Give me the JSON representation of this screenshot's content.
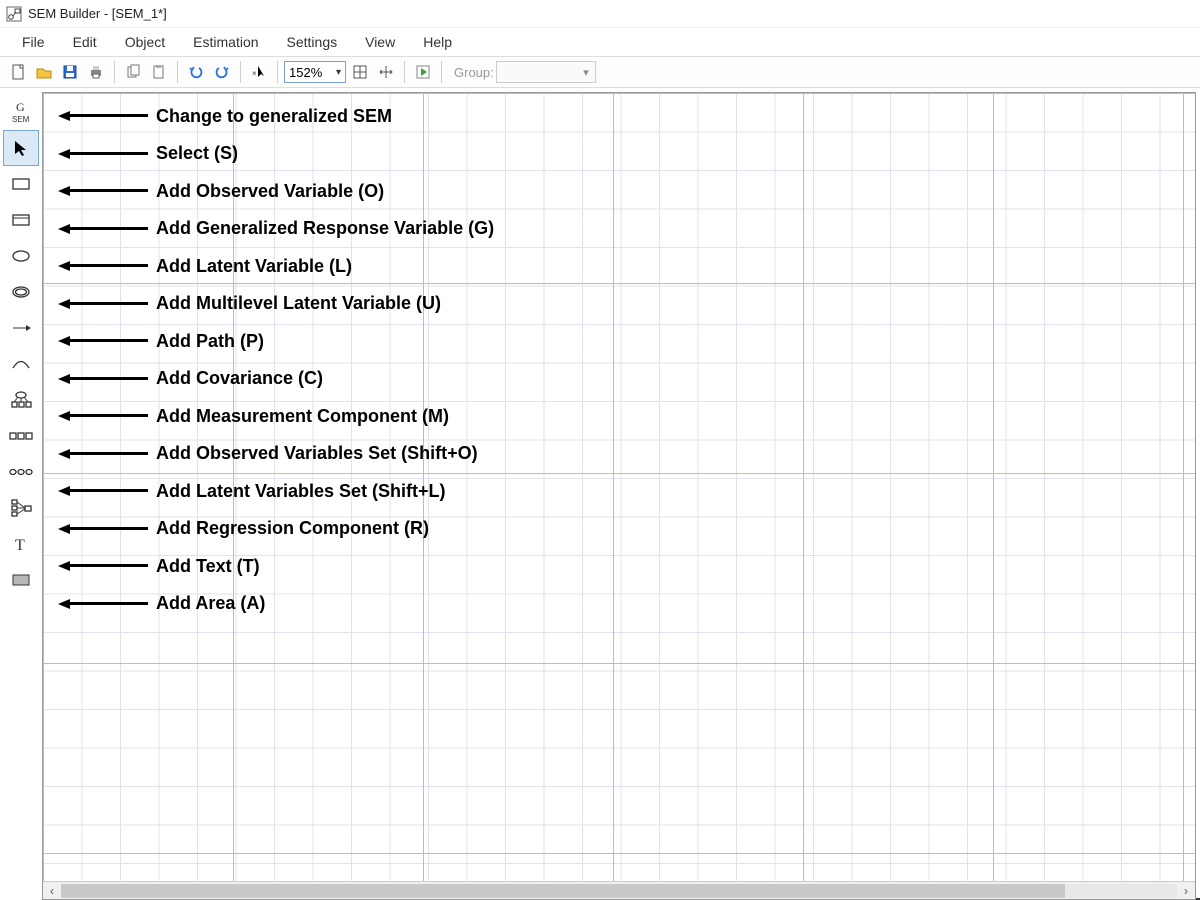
{
  "window": {
    "title": "SEM Builder - [SEM_1*]"
  },
  "menu": {
    "items": [
      "File",
      "Edit",
      "Object",
      "Estimation",
      "Settings",
      "View",
      "Help"
    ]
  },
  "toolbar": {
    "zoom_value": "152%",
    "group_label": "Group:",
    "buttons": [
      "new-file",
      "open-file",
      "save",
      "print",
      "copy",
      "paste",
      "undo",
      "redo",
      "pointer",
      "zoom-select",
      "fit-page",
      "fit-width",
      "play"
    ]
  },
  "palette": {
    "tools": [
      {
        "id": "gsem",
        "icon": "gsem",
        "selected": false
      },
      {
        "id": "select",
        "icon": "pointer",
        "selected": true
      },
      {
        "id": "observed",
        "icon": "rect",
        "selected": false
      },
      {
        "id": "gen-response",
        "icon": "rect-band",
        "selected": false
      },
      {
        "id": "latent",
        "icon": "ellipse",
        "selected": false
      },
      {
        "id": "multilevel",
        "icon": "double-ell",
        "selected": false
      },
      {
        "id": "path",
        "icon": "arrow-right",
        "selected": false
      },
      {
        "id": "covariance",
        "icon": "arc",
        "selected": false
      },
      {
        "id": "measurement",
        "icon": "measure",
        "selected": false
      },
      {
        "id": "observed-set",
        "icon": "rect-set",
        "selected": false
      },
      {
        "id": "latent-set",
        "icon": "ell-set",
        "selected": false
      },
      {
        "id": "regression",
        "icon": "regress",
        "selected": false
      },
      {
        "id": "text",
        "icon": "text",
        "selected": false
      },
      {
        "id": "area",
        "icon": "filled-rect",
        "selected": false
      }
    ]
  },
  "annotations": [
    "Change to generalized SEM",
    "Select (S)",
    "Add Observed Variable (O)",
    "Add Generalized Response Variable (G)",
    "Add Latent Variable (L)",
    "Add Multilevel Latent Variable (U)",
    "Add Path (P)",
    "Add Covariance (C)",
    "Add Measurement Component (M)",
    "Add Observed Variables Set (Shift+O)",
    "Add Latent Variables Set (Shift+L)",
    "Add Regression Component (R)",
    "Add Text (T)",
    "Add Area (A)"
  ]
}
